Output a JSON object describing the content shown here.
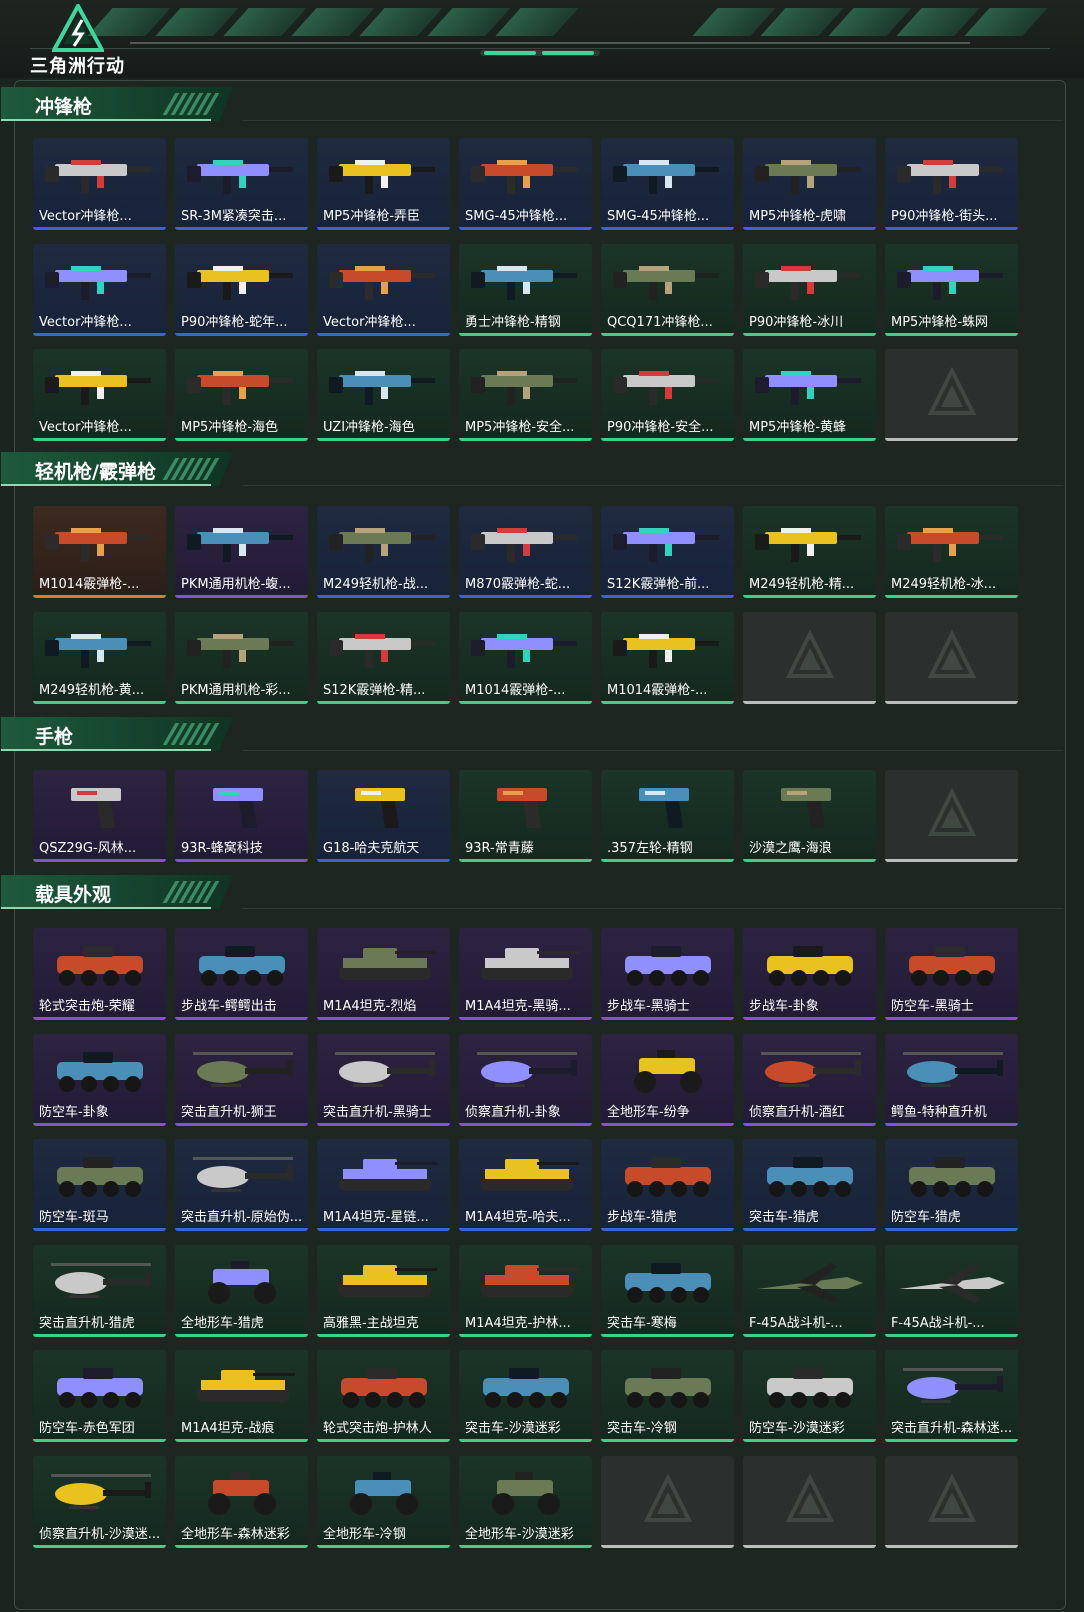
{
  "brand": {
    "name": "三角洲行动"
  },
  "sections": [
    {
      "title": "冲锋枪",
      "items": [
        {
          "label": "Vector冲锋枪...",
          "quality": "blue",
          "icon": "smg-icon"
        },
        {
          "label": "SR-3M紧凑突击...",
          "quality": "blue",
          "icon": "smg-icon"
        },
        {
          "label": "MP5冲锋枪-弄臣",
          "quality": "blue",
          "icon": "smg-icon"
        },
        {
          "label": "SMG-45冲锋枪...",
          "quality": "blue",
          "icon": "smg-icon"
        },
        {
          "label": "SMG-45冲锋枪...",
          "quality": "blue",
          "icon": "smg-icon"
        },
        {
          "label": "MP5冲锋枪-虎啸",
          "quality": "blue",
          "icon": "smg-icon"
        },
        {
          "label": "P90冲锋枪-街头...",
          "quality": "blue",
          "icon": "smg-icon"
        },
        {
          "label": "Vector冲锋枪...",
          "quality": "blue",
          "icon": "smg-icon"
        },
        {
          "label": "P90冲锋枪-蛇年...",
          "quality": "blue",
          "icon": "smg-icon"
        },
        {
          "label": "Vector冲锋枪...",
          "quality": "blue",
          "icon": "smg-icon"
        },
        {
          "label": "勇士冲锋枪-精钢",
          "quality": "green",
          "icon": "smg-icon"
        },
        {
          "label": "QCQ171冲锋枪...",
          "quality": "green",
          "icon": "smg-icon"
        },
        {
          "label": "P90冲锋枪-冰川",
          "quality": "green",
          "icon": "smg-icon"
        },
        {
          "label": "MP5冲锋枪-蛛网",
          "quality": "green",
          "icon": "smg-icon"
        },
        {
          "label": "Vector冲锋枪...",
          "quality": "green",
          "icon": "smg-icon"
        },
        {
          "label": "MP5冲锋枪-海色",
          "quality": "green",
          "icon": "smg-icon"
        },
        {
          "label": "UZI冲锋枪-海色",
          "quality": "green",
          "icon": "smg-icon"
        },
        {
          "label": "MP5冲锋枪-安全...",
          "quality": "green",
          "icon": "smg-icon"
        },
        {
          "label": "P90冲锋枪-安全...",
          "quality": "green",
          "icon": "smg-icon"
        },
        {
          "label": "MP5冲锋枪-黄蜂",
          "quality": "green",
          "icon": "smg-icon"
        },
        {
          "label": "",
          "quality": "empty",
          "icon": "empty-slot-icon"
        }
      ]
    },
    {
      "title": "轻机枪/霰弹枪",
      "items": [
        {
          "label": "M1014霰弹枪-...",
          "quality": "orange",
          "icon": "shotgun-icon"
        },
        {
          "label": "PKM通用机枪-蝮...",
          "quality": "purple",
          "icon": "lmg-icon"
        },
        {
          "label": "M249轻机枪-战...",
          "quality": "blue",
          "icon": "lmg-icon"
        },
        {
          "label": "M870霰弹枪-蛇...",
          "quality": "blue",
          "icon": "shotgun-icon"
        },
        {
          "label": "S12K霰弹枪-前...",
          "quality": "blue",
          "icon": "shotgun-icon"
        },
        {
          "label": "M249轻机枪-精...",
          "quality": "green",
          "icon": "lmg-icon"
        },
        {
          "label": "M249轻机枪-冰...",
          "quality": "green",
          "icon": "lmg-icon"
        },
        {
          "label": "M249轻机枪-黄...",
          "quality": "green",
          "icon": "lmg-icon"
        },
        {
          "label": "PKM通用机枪-彩...",
          "quality": "green",
          "icon": "lmg-icon"
        },
        {
          "label": "S12K霰弹枪-精...",
          "quality": "green",
          "icon": "shotgun-icon"
        },
        {
          "label": "M1014霰弹枪-...",
          "quality": "green",
          "icon": "shotgun-icon"
        },
        {
          "label": "M1014霰弹枪-...",
          "quality": "green",
          "icon": "shotgun-icon"
        },
        {
          "label": "",
          "quality": "empty",
          "icon": "empty-slot-icon"
        },
        {
          "label": "",
          "quality": "empty",
          "icon": "empty-slot-icon"
        }
      ]
    },
    {
      "title": "手枪",
      "items": [
        {
          "label": "QSZ29G-风林...",
          "quality": "purple",
          "icon": "pistol-icon"
        },
        {
          "label": "93R-蜂窝科技",
          "quality": "purple",
          "icon": "pistol-icon"
        },
        {
          "label": "G18-哈夫克航天",
          "quality": "blue",
          "icon": "pistol-icon"
        },
        {
          "label": "93R-常青藤",
          "quality": "green",
          "icon": "pistol-icon"
        },
        {
          "label": ".357左轮-精钢",
          "quality": "green",
          "icon": "revolver-icon"
        },
        {
          "label": "沙漠之鹰-海浪",
          "quality": "green",
          "icon": "pistol-icon"
        },
        {
          "label": "",
          "quality": "empty",
          "icon": "empty-slot-icon"
        }
      ]
    },
    {
      "title": "载具外观",
      "items": [
        {
          "label": "轮式突击炮-荣耀",
          "quality": "purple",
          "icon": "armored-car-icon"
        },
        {
          "label": "步战车-鳄鳄出击",
          "quality": "purple",
          "icon": "ifv-icon"
        },
        {
          "label": "M1A4坦克-烈焰",
          "quality": "purple",
          "icon": "tank-icon"
        },
        {
          "label": "M1A4坦克-黑骑...",
          "quality": "purple",
          "icon": "tank-icon"
        },
        {
          "label": "步战车-黑骑士",
          "quality": "purple",
          "icon": "ifv-icon"
        },
        {
          "label": "步战车-卦象",
          "quality": "purple",
          "icon": "ifv-icon"
        },
        {
          "label": "防空车-黑骑士",
          "quality": "purple",
          "icon": "ifv-icon"
        },
        {
          "label": "防空车-卦象",
          "quality": "purple",
          "icon": "ifv-icon"
        },
        {
          "label": "突击直升机-狮王",
          "quality": "purple",
          "icon": "helicopter-icon"
        },
        {
          "label": "突击直升机-黑骑士",
          "quality": "purple",
          "icon": "helicopter-icon"
        },
        {
          "label": "侦察直升机-卦象",
          "quality": "purple",
          "icon": "helicopter-icon"
        },
        {
          "label": "全地形车-纷争",
          "quality": "purple",
          "icon": "atv-icon"
        },
        {
          "label": "侦察直升机-酒红",
          "quality": "purple",
          "icon": "helicopter-icon"
        },
        {
          "label": "鳄鱼-特种直升机",
          "quality": "purple",
          "icon": "helicopter-icon"
        },
        {
          "label": "防空车-斑马",
          "quality": "blue",
          "icon": "armored-car-icon"
        },
        {
          "label": "突击直升机-原始伪...",
          "quality": "blue",
          "icon": "helicopter-icon"
        },
        {
          "label": "M1A4坦克-星链...",
          "quality": "blue",
          "icon": "tank-icon"
        },
        {
          "label": "M1A4坦克-哈夫...",
          "quality": "blue",
          "icon": "tank-icon"
        },
        {
          "label": "步战车-猎虎",
          "quality": "blue",
          "icon": "ifv-icon"
        },
        {
          "label": "突击车-猎虎",
          "quality": "blue",
          "icon": "armored-car-icon"
        },
        {
          "label": "防空车-猎虎",
          "quality": "blue",
          "icon": "ifv-icon"
        },
        {
          "label": "突击直升机-猎虎",
          "quality": "green",
          "icon": "helicopter-icon"
        },
        {
          "label": "全地形车-猎虎",
          "quality": "green",
          "icon": "atv-icon"
        },
        {
          "label": "高雅黑-主战坦克",
          "quality": "green",
          "icon": "tank-icon"
        },
        {
          "label": "M1A4坦克-护林...",
          "quality": "green",
          "icon": "tank-icon"
        },
        {
          "label": "突击车-寒梅",
          "quality": "green",
          "icon": "armored-car-icon"
        },
        {
          "label": "F-45A战斗机-...",
          "quality": "green",
          "icon": "jet-icon"
        },
        {
          "label": "F-45A战斗机-...",
          "quality": "green",
          "icon": "jet-icon"
        },
        {
          "label": "防空车-赤色军团",
          "quality": "green",
          "icon": "ifv-icon"
        },
        {
          "label": "M1A4坦克-战痕",
          "quality": "green",
          "icon": "tank-icon"
        },
        {
          "label": "轮式突击炮-护林人",
          "quality": "green",
          "icon": "armored-car-icon"
        },
        {
          "label": "突击车-沙漠迷彩",
          "quality": "green",
          "icon": "armored-car-icon"
        },
        {
          "label": "突击车-冷钢",
          "quality": "green",
          "icon": "armored-car-icon"
        },
        {
          "label": "防空车-沙漠迷彩",
          "quality": "green",
          "icon": "ifv-icon"
        },
        {
          "label": "突击直升机-森林迷...",
          "quality": "green",
          "icon": "helicopter-icon"
        },
        {
          "label": "侦察直升机-沙漠迷...",
          "quality": "green",
          "icon": "helicopter-icon"
        },
        {
          "label": "全地形车-森林迷彩",
          "quality": "green",
          "icon": "atv-icon"
        },
        {
          "label": "全地形车-冷钢",
          "quality": "green",
          "icon": "atv-icon"
        },
        {
          "label": "全地形车-沙漠迷彩",
          "quality": "green",
          "icon": "atv-icon"
        },
        {
          "label": "",
          "quality": "empty",
          "icon": "empty-slot-icon"
        },
        {
          "label": "",
          "quality": "empty",
          "icon": "empty-slot-icon"
        },
        {
          "label": "",
          "quality": "empty",
          "icon": "empty-slot-icon"
        }
      ]
    }
  ],
  "colors": {
    "blue": "#3c63d8",
    "green": "#3fcf86",
    "purple": "#8c4ed8",
    "orange": "#e07a22",
    "accent": "#3fd69a"
  }
}
